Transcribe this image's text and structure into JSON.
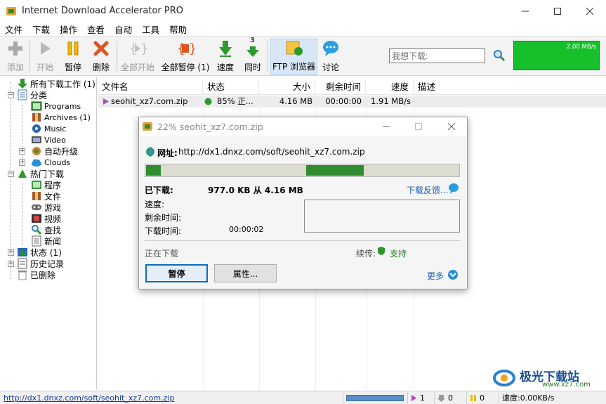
{
  "window": {
    "title": "Internet Download Accelerator PRO"
  },
  "menu": [
    "文件",
    "下载",
    "操作",
    "查看",
    "自动",
    "工具",
    "帮助"
  ],
  "toolbar": {
    "add": "添加",
    "start": "开始",
    "pause": "暂停",
    "delete": "删除",
    "start_all": "全部开始",
    "pause_all": "全部暂停 (1)",
    "speed": "速度",
    "simultaneous": "同时",
    "simultaneous_badge": "3",
    "ftp_browser": "FTP 浏览器",
    "discuss": "讨论"
  },
  "search": {
    "placeholder": "我想下载:"
  },
  "speed_graph": {
    "label": "2.00 MB/s",
    "color": "#16c02a"
  },
  "tree": {
    "all_downloads": "所有下载工作 (1)",
    "categories": "分类",
    "cat_items": [
      "Programs",
      "Archives (1)",
      "Music",
      "Video",
      "自动升级",
      "Clouds"
    ],
    "hot_downloads": "热门下载",
    "hot_items": [
      "程序",
      "文件",
      "游戏",
      "视频",
      "查找",
      "新闻"
    ],
    "status": "状态 (1)",
    "history": "历史记录",
    "deleted": "已删除"
  },
  "list": {
    "columns": [
      "文件名",
      "状态",
      "大小",
      "剩余时间",
      "速度",
      "描述"
    ],
    "rows": [
      {
        "filename": "seohit_xz7.com.zip",
        "status": "85% 正...",
        "size": "4.16 MB",
        "remaining": "00:00:00",
        "speed": "1.91 MB/s",
        "description": ""
      }
    ]
  },
  "dialog": {
    "title": "22% seohit_xz7.com.zip",
    "url_label": "网址:",
    "url": "http://dx1.dnxz.com/soft/seohit_xz7.com.zip",
    "downloaded_label": "已下载:",
    "downloaded_value": "977.0 KB 从 4.16 MB",
    "feedback": "下载反馈...",
    "speed_label": "速度:",
    "remaining_label": "剩余时间:",
    "download_time_label": "下载时间:",
    "download_time_value": "00:00:02",
    "status_text": "正在下载",
    "resume_label": "续传:",
    "resume_value": "支持",
    "pause_btn": "暂停",
    "properties_btn": "属性...",
    "more": "更多"
  },
  "statusbar": {
    "url": "http://dx1.dnxz.com/soft/seohit_xz7.com.zip",
    "active_count": "1",
    "queued_count": "0",
    "paused_count": "0",
    "speed_text": "速度:0.00KB/s"
  },
  "watermark": {
    "text": "极光下载站",
    "sub": "www.xz7.com"
  }
}
